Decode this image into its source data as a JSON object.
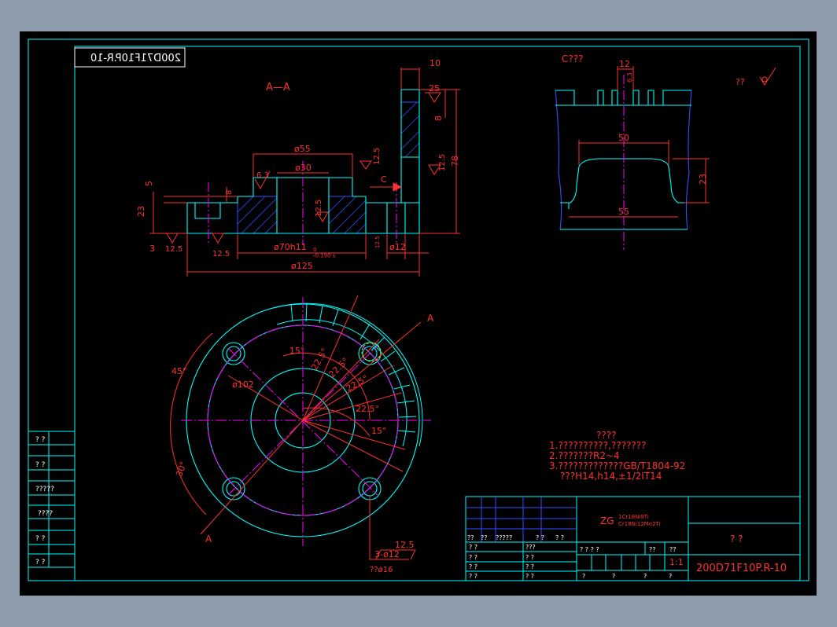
{
  "colors": {
    "background": "#8d9bab",
    "paper": "#000000",
    "border": "#00ffff",
    "dimension": "#ff3030",
    "geometry": "#00ffff",
    "centerline": "#ff00ff",
    "hatch": "#3050ff",
    "text_white": "#ffffff",
    "yellow": "#e0e000"
  },
  "drawing": {
    "stamp_code": "200D71F10P.R-10",
    "section_label": "A—A",
    "view_c_label": "C???",
    "roughness_note": "??",
    "cut_mark_top": "A",
    "cut_mark_bottom": "A",
    "view_arrow_label": "C"
  },
  "section_dims": {
    "d10": "10",
    "d25": "25",
    "d8_right": "8",
    "d78": "78",
    "d55": "ø55",
    "d30": "ø30",
    "d63": "6.3",
    "d125_r1": "12.5",
    "d125_r2": "12.5",
    "d125_r3": "12.5",
    "d5": "5",
    "d8": "8",
    "d23": "23",
    "d3": "3",
    "d125_b1": "12.5",
    "d125_b2": "12.5",
    "d70": "ø70h11",
    "d70_tol": "0\n-0.190 s",
    "d12": "ø12",
    "d125_total": "ø125",
    "d125_small": "12.5"
  },
  "view_c_dims": {
    "d12": "12",
    "d50": "50",
    "d55": "55",
    "d23": "23",
    "d_small": "6.3"
  },
  "plan_dims": {
    "a45": "45°",
    "a30": "30°",
    "d102": "ø102",
    "a15a": "15°",
    "a225a": "22.5°",
    "a225b": "22.5°",
    "a225c": "22.5°",
    "a225d": "22.5°",
    "a15b": "15°",
    "holes": "3-ø12",
    "holes_rough": "12.5",
    "holes_cb": "??ø16"
  },
  "notes": {
    "title": "????",
    "line1": "1.??????????,???????",
    "line2": "2.???????R2~4",
    "line3": "3.?????????????GB/T1804-92",
    "line4": "???H14,h14,±1/2IT14"
  },
  "title_block": {
    "material_prefix": "ZG",
    "material_1": "1Cr18Ni9Ti",
    "material_2": "Cr18Ni12Mo2Ti",
    "part_name": "?  ?",
    "drawing_no": "200D71F10P.R-10",
    "scale": "1:1",
    "row_a": [
      "??",
      "??",
      "?????",
      "? ?",
      "? ?"
    ],
    "row_b": [
      "? ?",
      "???",
      "? ? ? ?",
      "??",
      "??"
    ],
    "row_c": [
      "? ?",
      "? ?"
    ],
    "row_d": [
      "? ?",
      "? ?"
    ],
    "row_e": [
      "? ?",
      "? ?",
      "?",
      "?",
      "?",
      "?"
    ]
  },
  "side_column": {
    "cells": [
      "?  ?",
      "?  ?",
      "?????",
      "????",
      "?  ?",
      "?  ?"
    ]
  }
}
